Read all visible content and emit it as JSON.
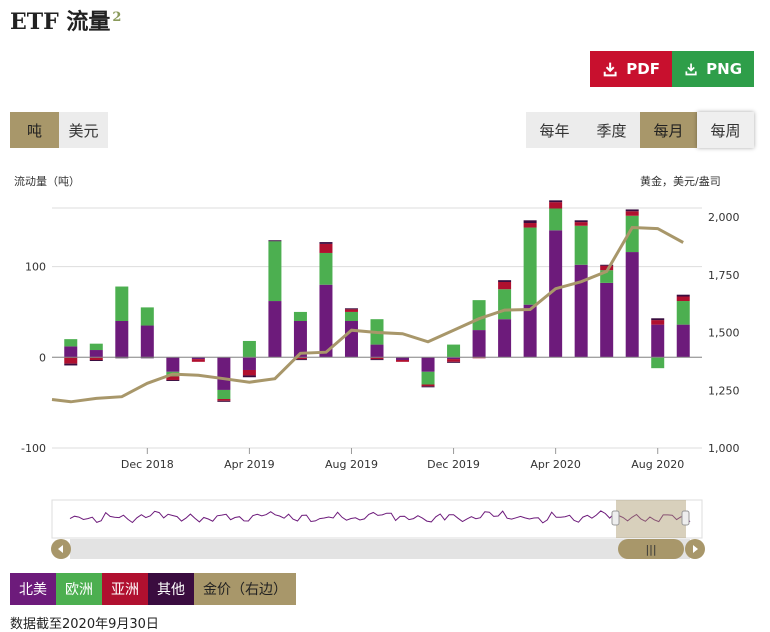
{
  "header": {
    "title": "ETF 流量",
    "sup": "2"
  },
  "downloads": {
    "pdf": "PDF",
    "png": "PNG"
  },
  "units": [
    "吨",
    "美元"
  ],
  "periods": [
    "每年",
    "季度",
    "每月",
    "每周"
  ],
  "axis_titles": {
    "left": "流动量（吨）",
    "right": "黄金，美元/盎司"
  },
  "legend": [
    {
      "label": "北美",
      "color": "#6d1b7b"
    },
    {
      "label": "欧洲",
      "color": "#4caf50"
    },
    {
      "label": "亚洲",
      "color": "#b0102f"
    },
    {
      "label": "其他",
      "color": "#3a0c3f"
    },
    {
      "label": "金价（右边）",
      "color": "#a8976a"
    }
  ],
  "note": "数据截至2020年9月30日",
  "chart_data": {
    "type": "bar",
    "stacked": true,
    "x_tick_labels": [
      "Dec 2018",
      "Apr 2019",
      "Aug 2019",
      "Dec 2019",
      "Apr 2020",
      "Aug 2020"
    ],
    "months": [
      "2018-09",
      "2018-10",
      "2018-11",
      "2018-12",
      "2019-01",
      "2019-02",
      "2019-03",
      "2019-04",
      "2019-05",
      "2019-06",
      "2019-07",
      "2019-08",
      "2019-09",
      "2019-10",
      "2019-11",
      "2019-12",
      "2020-01",
      "2020-02",
      "2020-03",
      "2020-04",
      "2020-05",
      "2020-06",
      "2020-07",
      "2020-08",
      "2020-09"
    ],
    "ylim": [
      -100,
      180
    ],
    "yticks": [
      -100,
      0,
      100
    ],
    "y2lim": [
      1000,
      2100
    ],
    "y2ticks": [
      "1,000",
      "1,250",
      "1,500",
      "1,750",
      "2,000"
    ],
    "grid": true,
    "series": [
      {
        "name": "北美",
        "values": [
          12,
          8,
          40,
          35,
          -16,
          -2,
          -36,
          -14,
          62,
          40,
          80,
          40,
          14,
          -3,
          -16,
          -2,
          30,
          42,
          58,
          140,
          102,
          82,
          116,
          36,
          36
        ]
      },
      {
        "name": "欧洲",
        "values": [
          8,
          7,
          38,
          20,
          -5,
          0,
          -10,
          18,
          66,
          10,
          35,
          10,
          28,
          0,
          -14,
          14,
          33,
          33,
          85,
          24,
          43,
          14,
          40,
          -12,
          26
        ]
      },
      {
        "name": "亚洲",
        "values": [
          -7,
          -3,
          0,
          0,
          -4,
          -3,
          -2,
          -6,
          0,
          -2,
          10,
          3,
          -2,
          -2,
          -2,
          -3,
          -1,
          8,
          5,
          7,
          4,
          5,
          5,
          5,
          5
        ]
      },
      {
        "name": "其他",
        "values": [
          -2,
          -1,
          -1,
          -1,
          -1,
          0,
          -1,
          -2,
          1,
          -1,
          2,
          1,
          -1,
          0,
          -1,
          -1,
          0,
          2,
          3,
          2,
          2,
          1,
          2,
          2,
          2
        ]
      }
    ],
    "gold_price": {
      "name": "金价（右边）",
      "values": [
        1200,
        1215,
        1222,
        1280,
        1320,
        1315,
        1300,
        1285,
        1300,
        1410,
        1415,
        1510,
        1500,
        1495,
        1460,
        1510,
        1560,
        1597,
        1600,
        1690,
        1720,
        1765,
        1955,
        1950,
        1890
      ]
    }
  }
}
